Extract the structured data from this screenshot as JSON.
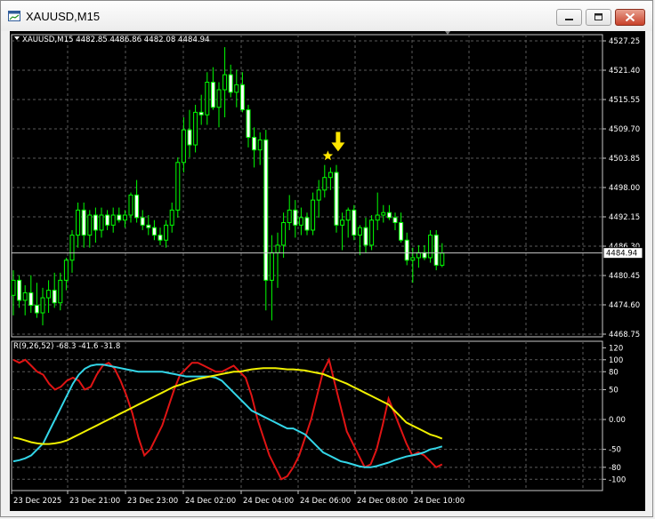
{
  "window": {
    "title": "XAUUSD,M15"
  },
  "chart": {
    "header": "XAUUSD,M15  4482.85 4486.86 4482.08 4484.94",
    "current_price": "4484.94",
    "price_ticks": [
      "4527.25",
      "4521.40",
      "4515.55",
      "4509.70",
      "4503.85",
      "4498.00",
      "4492.15",
      "4486.30",
      "4480.45",
      "4474.60",
      "4468.75"
    ],
    "time_ticks": [
      "23 Dec 2025",
      "23 Dec 21:00",
      "23 Dec 23:00",
      "24 Dec 02:00",
      "24 Dec 04:00",
      "24 Dec 06:00",
      "24 Dec 08:00",
      "24 Dec 10:00"
    ],
    "colors": {
      "background": "#000000",
      "bull": "#00ff00",
      "bear": "#ffffff",
      "grid": "#5a5a5a",
      "marker": "#ffe600"
    }
  },
  "indicator": {
    "header": "R(9,26,52) -68.3 -41.6 -31.8",
    "ticks": [
      "120",
      "100",
      "80",
      "50",
      "0.00",
      "-50",
      "-80",
      "-100"
    ],
    "colors": {
      "red": "#e01414",
      "cyan": "#33d6e8",
      "yellow": "#f0f000"
    }
  },
  "chart_data": {
    "type": "candlestick",
    "symbol": "XAUUSD",
    "timeframe": "M15",
    "ohlc_header": {
      "open": 4482.85,
      "high": 4486.86,
      "low": 4482.08,
      "close": 4484.94
    },
    "price_range": [
      4468.75,
      4527.25
    ],
    "candles": [
      [
        4476.5,
        4481.5,
        4472.5,
        4479.5
      ],
      [
        4479.5,
        4480.5,
        4474.0,
        4475.5
      ],
      [
        4475.5,
        4478.5,
        4472.5,
        4477.0
      ],
      [
        4477.0,
        4480.5,
        4473.0,
        4474.5
      ],
      [
        4474.5,
        4479.0,
        4472.0,
        4473.0
      ],
      [
        4473.0,
        4478.0,
        4470.5,
        4476.0
      ],
      [
        4476.0,
        4479.5,
        4473.0,
        4477.5
      ],
      [
        4477.5,
        4481.0,
        4474.0,
        4475.0
      ],
      [
        4475.0,
        4481.0,
        4473.5,
        4479.5
      ],
      [
        4479.5,
        4484.0,
        4477.5,
        4483.5
      ],
      [
        4483.5,
        4489.5,
        4481.0,
        4488.5
      ],
      [
        4488.5,
        4495.0,
        4486.0,
        4493.5
      ],
      [
        4493.5,
        4495.0,
        4486.0,
        4488.5
      ],
      [
        4488.5,
        4493.5,
        4486.0,
        4492.5
      ],
      [
        4492.5,
        4494.0,
        4487.0,
        4489.5
      ],
      [
        4489.5,
        4494.0,
        4488.0,
        4492.5
      ],
      [
        4492.5,
        4493.5,
        4489.5,
        4490.5
      ],
      [
        4490.5,
        4494.0,
        4489.0,
        4492.5
      ],
      [
        4492.5,
        4494.0,
        4491.0,
        4491.5
      ],
      [
        4491.5,
        4493.5,
        4490.0,
        4492.5
      ],
      [
        4492.5,
        4497.0,
        4491.0,
        4496.5
      ],
      [
        4496.5,
        4499.5,
        4491.0,
        4492.0
      ],
      [
        4492.0,
        4493.5,
        4489.5,
        4490.5
      ],
      [
        4490.5,
        4492.5,
        4488.5,
        4490.0
      ],
      [
        4490.0,
        4491.5,
        4487.5,
        4488.5
      ],
      [
        4488.5,
        4490.0,
        4486.5,
        4487.5
      ],
      [
        4487.5,
        4491.5,
        4486.0,
        4490.5
      ],
      [
        4490.5,
        4495.0,
        4489.0,
        4493.5
      ],
      [
        4493.5,
        4504.0,
        4492.0,
        4503.0
      ],
      [
        4503.0,
        4512.0,
        4501.0,
        4509.5
      ],
      [
        4509.5,
        4513.5,
        4504.0,
        4506.5
      ],
      [
        4506.5,
        4514.5,
        4505.0,
        4513.0
      ],
      [
        4513.0,
        4516.5,
        4510.5,
        4512.5
      ],
      [
        4512.5,
        4521.0,
        4510.5,
        4519.0
      ],
      [
        4519.0,
        4522.0,
        4513.5,
        4514.0
      ],
      [
        4514.0,
        4519.0,
        4510.0,
        4517.5
      ],
      [
        4517.5,
        4526.0,
        4512.0,
        4520.5
      ],
      [
        4520.5,
        4522.5,
        4516.0,
        4517.0
      ],
      [
        4517.0,
        4521.5,
        4514.0,
        4518.5
      ],
      [
        4518.5,
        4521.0,
        4513.0,
        4513.5
      ],
      [
        4513.5,
        4514.5,
        4506.0,
        4508.0
      ],
      [
        4508.0,
        4510.0,
        4502.0,
        4505.5
      ],
      [
        4505.5,
        4509.0,
        4502.5,
        4507.5
      ],
      [
        4507.5,
        4509.5,
        4473.5,
        4479.5
      ],
      [
        4479.5,
        4488.5,
        4471.5,
        4485.0
      ],
      [
        4485.0,
        4489.0,
        4478.0,
        4486.5
      ],
      [
        4486.5,
        4493.0,
        4484.0,
        4491.0
      ],
      [
        4491.0,
        4496.5,
        4489.5,
        4493.5
      ],
      [
        4493.5,
        4495.5,
        4488.0,
        4490.5
      ],
      [
        4490.5,
        4494.0,
        4488.5,
        4492.0
      ],
      [
        4492.0,
        4493.0,
        4488.5,
        4489.5
      ],
      [
        4489.5,
        4497.0,
        4488.5,
        4495.5
      ],
      [
        4495.5,
        4499.5,
        4492.0,
        4497.5
      ],
      [
        4497.5,
        4502.5,
        4496.0,
        4500.0
      ],
      [
        4500.0,
        4502.0,
        4497.5,
        4501.0
      ],
      [
        4501.0,
        4502.5,
        4489.0,
        4490.5
      ],
      [
        4490.5,
        4493.0,
        4485.5,
        4491.5
      ],
      [
        4491.5,
        4494.0,
        4488.0,
        4493.5
      ],
      [
        4493.5,
        4494.5,
        4487.5,
        4488.5
      ],
      [
        4488.5,
        4490.5,
        4484.5,
        4490.0
      ],
      [
        4490.0,
        4492.0,
        4485.0,
        4486.5
      ],
      [
        4486.5,
        4492.5,
        4485.5,
        4491.5
      ],
      [
        4491.5,
        4497.0,
        4489.5,
        4492.5
      ],
      [
        4492.5,
        4494.5,
        4491.0,
        4493.0
      ],
      [
        4493.0,
        4494.5,
        4491.5,
        4492.0
      ],
      [
        4492.0,
        4493.0,
        4489.5,
        4491.0
      ],
      [
        4491.0,
        4493.0,
        4487.0,
        4487.5
      ],
      [
        4487.5,
        4489.0,
        4482.5,
        4483.5
      ],
      [
        4483.5,
        4486.0,
        4479.0,
        4484.0
      ],
      [
        4484.0,
        4486.5,
        4482.0,
        4485.0
      ],
      [
        4485.0,
        4486.5,
        4483.5,
        4484.0
      ],
      [
        4484.0,
        4489.5,
        4483.0,
        4488.5
      ],
      [
        4488.5,
        4489.5,
        4481.5,
        4482.5
      ],
      [
        4482.5,
        4486.9,
        4482.1,
        4484.9
      ]
    ],
    "marker": {
      "type": "down-arrow-and-star",
      "candle_index": 54
    },
    "indicator": {
      "name": "R(9,26,52)",
      "values_shown": [
        -68.3,
        -41.6,
        -31.8
      ],
      "y_range": [
        -110,
        125
      ],
      "series": [
        {
          "color": "red",
          "values": [
            100,
            95,
            100,
            90,
            80,
            75,
            60,
            50,
            55,
            65,
            70,
            65,
            50,
            55,
            75,
            90,
            95,
            85,
            65,
            40,
            10,
            -30,
            -60,
            -50,
            -30,
            -10,
            20,
            50,
            75,
            85,
            95,
            95,
            90,
            85,
            80,
            80,
            85,
            90,
            80,
            70,
            40,
            0,
            -30,
            -60,
            -80,
            -100,
            -95,
            -80,
            -60,
            -30,
            0,
            40,
            80,
            100,
            60,
            20,
            -20,
            -40,
            -60,
            -80,
            -75,
            -50,
            -10,
            35,
            10,
            -15,
            -40,
            -60,
            -55,
            -60,
            -70,
            -80,
            -75
          ]
        },
        {
          "color": "cyan",
          "values": [
            -70,
            -68,
            -65,
            -60,
            -50,
            -40,
            -20,
            0,
            20,
            40,
            60,
            75,
            85,
            90,
            92,
            92,
            90,
            88,
            86,
            84,
            82,
            80,
            80,
            80,
            80,
            80,
            78,
            76,
            74,
            72,
            72,
            72,
            72,
            72,
            70,
            65,
            55,
            45,
            35,
            25,
            15,
            10,
            5,
            0,
            -5,
            -10,
            -15,
            -15,
            -20,
            -25,
            -35,
            -45,
            -55,
            -60,
            -65,
            -70,
            -72,
            -75,
            -78,
            -80,
            -80,
            -78,
            -75,
            -72,
            -68,
            -65,
            -62,
            -60,
            -58,
            -55,
            -50,
            -48,
            -45
          ]
        },
        {
          "color": "yellow",
          "values": [
            -30,
            -32,
            -35,
            -38,
            -40,
            -41,
            -41,
            -40,
            -38,
            -35,
            -30,
            -25,
            -20,
            -15,
            -10,
            -5,
            0,
            5,
            10,
            15,
            20,
            25,
            30,
            35,
            40,
            45,
            50,
            55,
            58,
            62,
            65,
            68,
            70,
            72,
            74,
            76,
            78,
            80,
            80,
            82,
            84,
            85,
            86,
            86,
            86,
            85,
            84,
            84,
            83,
            82,
            80,
            78,
            76,
            72,
            68,
            64,
            60,
            55,
            50,
            45,
            40,
            35,
            30,
            25,
            15,
            5,
            -5,
            -10,
            -15,
            -20,
            -25,
            -28,
            -32
          ]
        }
      ]
    }
  }
}
